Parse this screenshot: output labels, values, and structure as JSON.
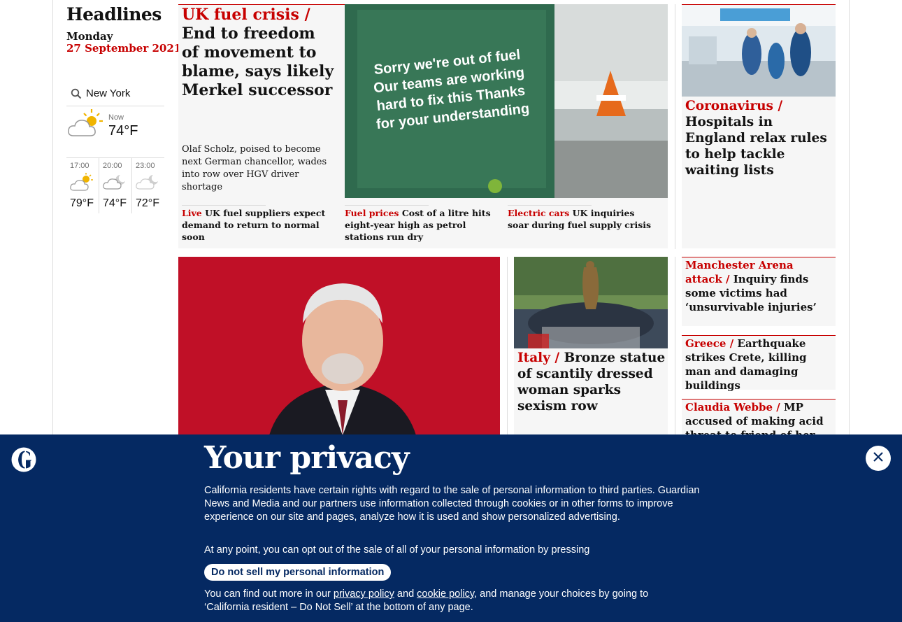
{
  "sidebar": {
    "title": "Headlines",
    "day": "Monday",
    "date": "27 September 2021"
  },
  "weather": {
    "location": "New York",
    "now_label": "Now",
    "now_temp": "74°F",
    "forecast": [
      {
        "time": "17:00",
        "temp": "79°F",
        "icon": "partly-sunny-icon"
      },
      {
        "time": "20:00",
        "temp": "74°F",
        "icon": "cloudy-night-icon"
      },
      {
        "time": "23:00",
        "temp": "72°F",
        "icon": "cloudy-night-icon"
      }
    ]
  },
  "lead": {
    "kicker": "UK fuel crisis /",
    "headline": "End to freedom of movement to blame, says likely Merkel successor",
    "standfirst": "Olaf Scholz, poised to become next German chancellor, wades into row over HGV driver shortage",
    "image_text": "Sorry we're out of fuel Our teams are working hard to fix this Thanks for your understanding",
    "subs": [
      {
        "kicker": "Live",
        "text": "UK fuel suppliers expect demand to return to normal soon"
      },
      {
        "kicker": "Fuel prices",
        "text": "Cost of a litre hits eight-year high as petrol stations run dry"
      },
      {
        "kicker": "Electric cars",
        "text": "UK inquiries soar during fuel supply crisis"
      }
    ]
  },
  "side_story": {
    "kicker": "Coronavirus /",
    "headline": "Hospitals in England relax rules to help tackle waiting lists"
  },
  "italy_story": {
    "kicker": "Italy /",
    "headline": "Bronze statue of scantily dressed woman sparks sexism row"
  },
  "right_list": [
    {
      "kicker": "Manchester Arena attack /",
      "headline": "Inquiry finds some victims had ‘unsurvivable injuries’"
    },
    {
      "kicker": "Greece /",
      "headline": "Earthquake strikes Crete, killing man and damaging buildings"
    },
    {
      "kicker": "Claudia Webbe /",
      "headline": "MP accused of making acid threat to friend of her"
    }
  ],
  "privacy": {
    "title": "Your privacy",
    "para1": "California residents have certain rights with regard to the sale of personal information to third parties. Guardian News and Media and our partners use information collected through cookies or in other forms to improve experience on our site and pages, analyze how it is used and show personalized advertising.",
    "para2": "At any point, you can opt out of the sale of all of your personal information by pressing",
    "button": "Do not sell my personal information",
    "para3_a": "You can find out more in our ",
    "privacy_link": "privacy policy",
    "para3_b": " and ",
    "cookie_link": "cookie policy",
    "para3_c": ", and manage your choices by going to ‘California resident – Do Not Sell’ at the bottom of any page."
  },
  "colors": {
    "brand_red": "#c70000",
    "overlay_blue": "#052962"
  }
}
